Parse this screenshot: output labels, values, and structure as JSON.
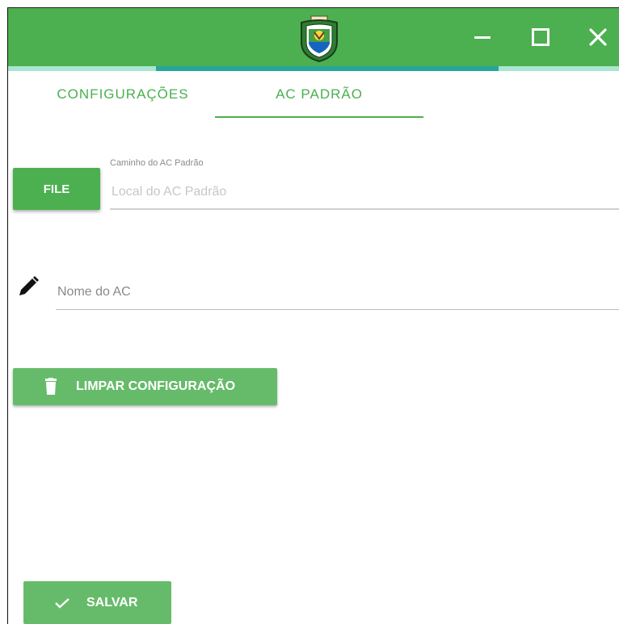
{
  "window": {
    "icons": {
      "logo": "state-coat-of-arms-icon",
      "minimize": "minimize-icon",
      "maximize": "maximize-icon",
      "close": "close-icon"
    }
  },
  "tabs": [
    {
      "label": "CONFIGURAÇÕES",
      "active": false
    },
    {
      "label": "AC PADRÃO",
      "active": true
    }
  ],
  "file_button": {
    "label": "FILE"
  },
  "path_field": {
    "label": "Caminho do AC Padrão",
    "placeholder": "Local do AC Padrão",
    "value": ""
  },
  "name_field": {
    "icon": "pencil-icon",
    "placeholder": "Nome do AC",
    "value": ""
  },
  "clear_button": {
    "label": "LIMPAR CONFIGURAÇÃO",
    "icon": "trash-icon"
  },
  "save_button": {
    "label": "SALVAR",
    "icon": "check-icon"
  },
  "colors": {
    "primary": "#4caf50",
    "button": "#66bb6a",
    "accent": "#26a69a",
    "shadow": "#a8e6cf"
  }
}
